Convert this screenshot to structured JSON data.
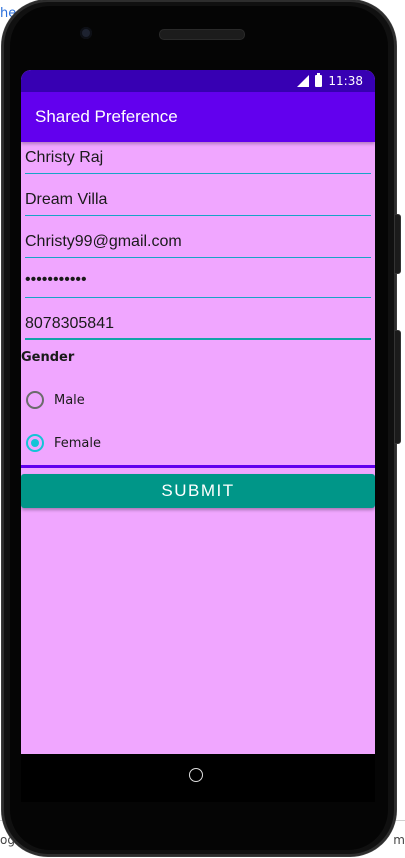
{
  "background": {
    "top_left_text": "he",
    "bottom_left_text": "og",
    "bottom_right_text": "m"
  },
  "status_bar": {
    "time": "11:38",
    "icons": [
      "signal-icon",
      "battery-icon"
    ]
  },
  "app_bar": {
    "title": "Shared Preference"
  },
  "form": {
    "name_value": "Christy Raj",
    "address_value": "Dream Villa",
    "email_value": "Christy99@gmail.com",
    "password_value": "•••••••••••",
    "phone_value": "8078305841",
    "gender_label": "Gender",
    "gender_options": [
      {
        "label": "Male",
        "selected": false
      },
      {
        "label": "Female",
        "selected": true
      }
    ],
    "submit_label": "SUBMIT"
  },
  "colors": {
    "status_bar": "#3700b3",
    "app_bar": "#6200ee",
    "screen_background": "#f0a6ff",
    "accent": "#14c4d6",
    "button": "#009688"
  }
}
